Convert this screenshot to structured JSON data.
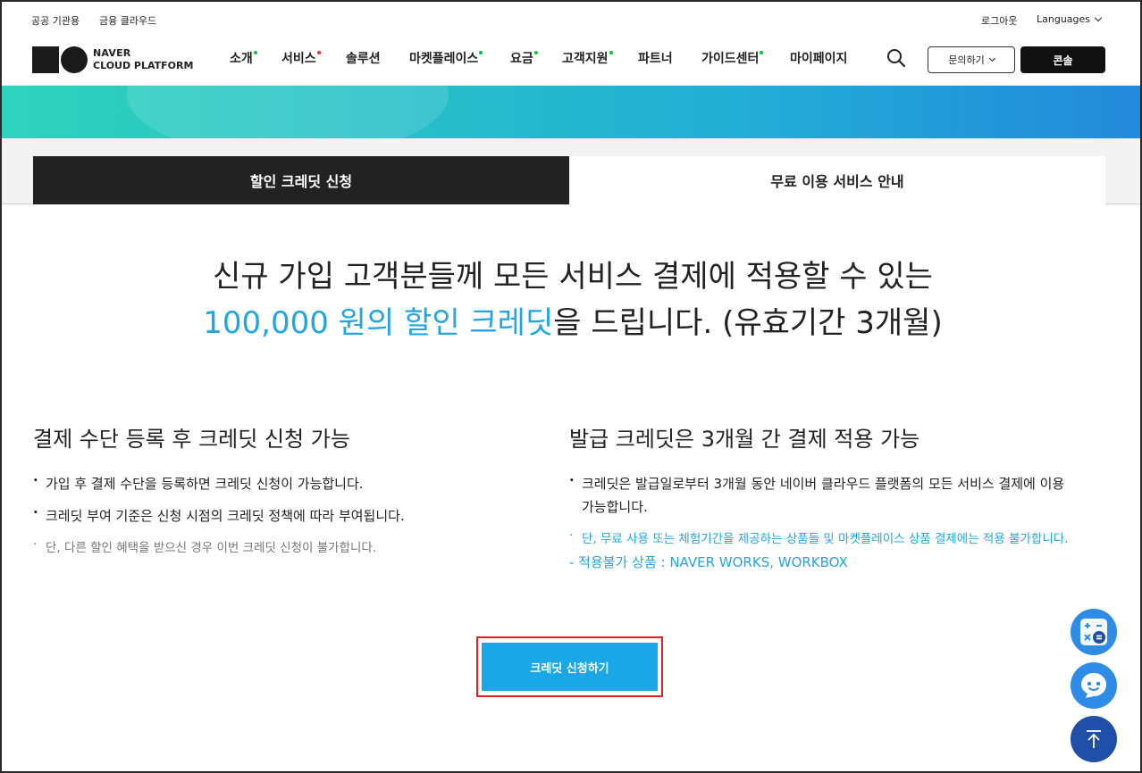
{
  "util": {
    "public": "공공 기관용",
    "finance": "금융 클라우드",
    "logout": "로그아웃",
    "languages": "Languages"
  },
  "logo": {
    "line1": "NAVER",
    "line2": "CLOUD PLATFORM"
  },
  "menu": [
    {
      "label": "소개",
      "dot": "green"
    },
    {
      "label": "서비스",
      "dot": "red"
    },
    {
      "label": "솔루션",
      "dot": ""
    },
    {
      "label": "마켓플레이스",
      "dot": "green"
    },
    {
      "label": "요금",
      "dot": "green"
    },
    {
      "label": "고객지원",
      "dot": "green"
    },
    {
      "label": "파트너",
      "dot": ""
    },
    {
      "label": "가이드센터",
      "dot": "green"
    },
    {
      "label": "마이페이지",
      "dot": ""
    }
  ],
  "header": {
    "inquiry": "문의하기",
    "console": "콘솔"
  },
  "tabs": {
    "active": "할인 크레딧 신청",
    "inactive": "무료 이용 서비스 안내"
  },
  "headline": {
    "line1": "신규 가입 고객분들께 모든 서비스 결제에 적용할 수 있는",
    "highlight": "100,000 원의 할인 크레딧",
    "line2_rest": "을 드립니다. (유효기간 3개월)"
  },
  "left": {
    "title": "결제 수단 등록 후 크레딧 신청 가능",
    "items": [
      "가입 후 결제 수단을 등록하면 크레딧 신청이 가능합니다.",
      "크레딧 부여 기준은 신청 시점의 크레딧 정책에 따라 부여됩니다."
    ],
    "note": "단, 다른 할인 혜택을 받으신 경우 이번 크레딧 신청이 불가합니다."
  },
  "right": {
    "title": "발급 크레딧은 3개월 간 결제 적용 가능",
    "items": [
      "크레딧은 발급일로부터 3개월 동안 네이버 클라우드 플랫폼의 모든 서비스 결제에 이용 가능합니다."
    ],
    "note1": "단, 무료 사용 또는 체험기간을 제공하는 상품들 및 마켓플레이스 상품 결제에는 적용 불가합니다.",
    "note2": "- 적용불가 상품 : NAVER WORKS, WORKBOX"
  },
  "cta": "크레딧 신청하기",
  "colors": {
    "accent": "#23a5e5",
    "cta": "#1aa7e6",
    "dark": "#222222",
    "highlight_border": "#e02020"
  }
}
